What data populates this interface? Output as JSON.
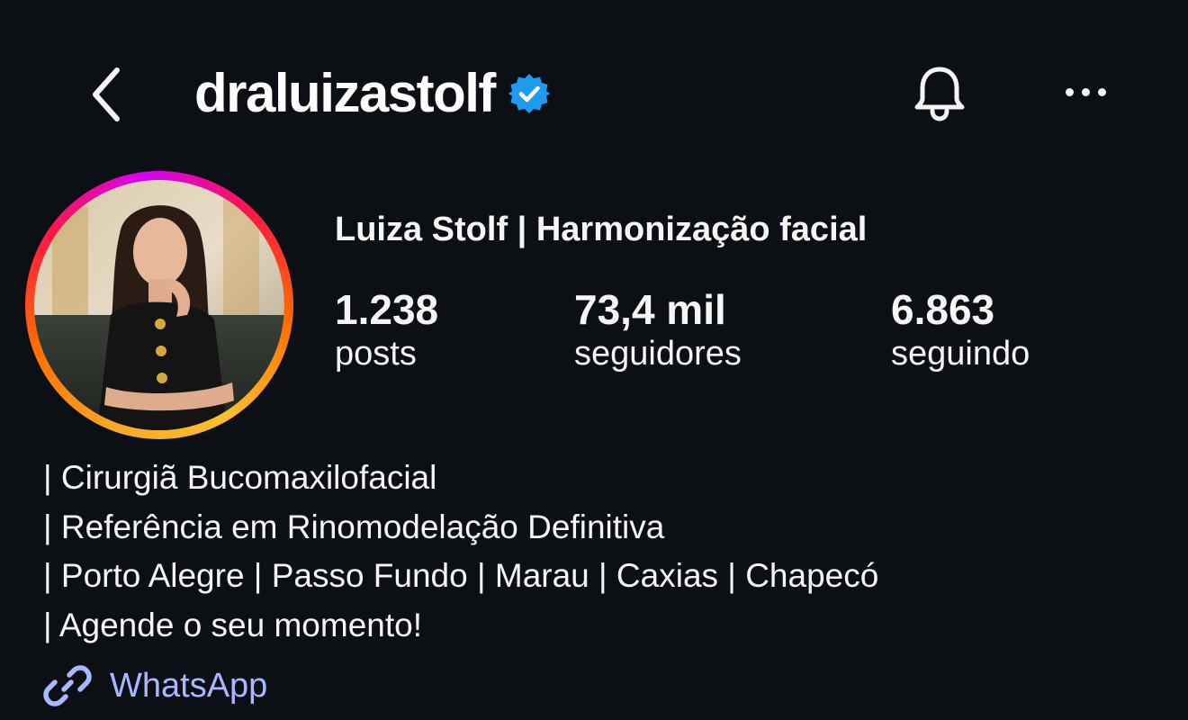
{
  "header": {
    "username": "draluizastolf",
    "verified": true,
    "icons": {
      "back": "chevron-left-icon",
      "verified": "verified-badge-icon",
      "notifications": "bell-icon",
      "more": "more-horizontal-icon"
    }
  },
  "profile": {
    "display_name": "Luiza Stolf | Harmonização facial",
    "stats": {
      "posts": {
        "value": "1.238",
        "label": "posts"
      },
      "followers": {
        "value": "73,4 mil",
        "label": "seguidores"
      },
      "following": {
        "value": "6.863",
        "label": "seguindo"
      }
    },
    "bio": [
      "| Cirurgiã Bucomaxilofacial",
      "| Referência em Rinomodelação Definitiva",
      "| Porto Alegre | Passo Fundo | Marau | Caxias | Chapecó",
      "| Agende o seu momento!"
    ],
    "link": {
      "label": "WhatsApp",
      "icon": "link-icon"
    }
  },
  "colors": {
    "background": "#0c1014",
    "text": "#f5f5f5",
    "verified_blue": "#1d9bf0",
    "link": "#a7b8ff",
    "story_ring": [
      "#fbc02d",
      "#ff6d00",
      "#ff1744",
      "#d500f9"
    ]
  }
}
